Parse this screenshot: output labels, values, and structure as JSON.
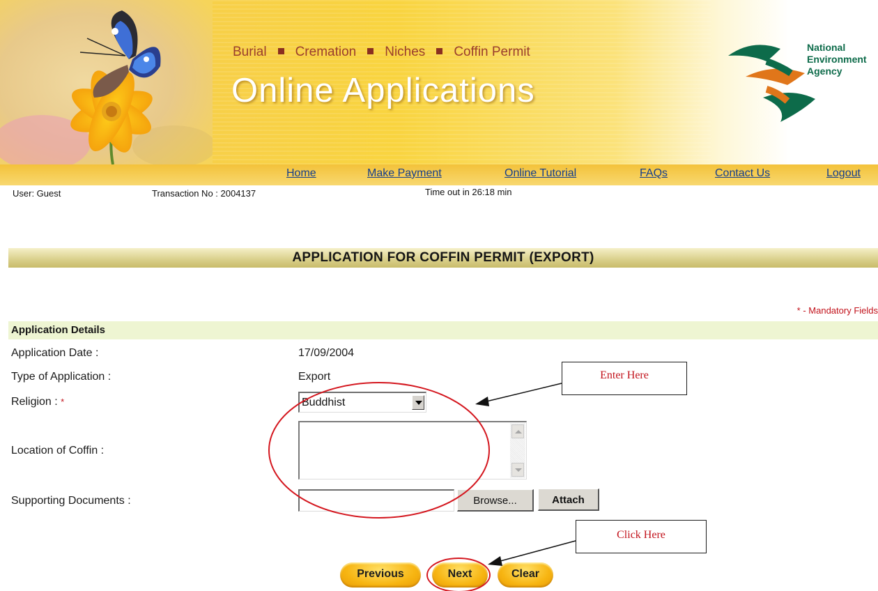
{
  "banner": {
    "service_links": [
      "Burial",
      "Cremation",
      "Niches",
      "Coffin Permit"
    ],
    "title": "Online Applications",
    "agency_name_lines": [
      "National",
      "Environment",
      "Agency"
    ]
  },
  "nav": {
    "items": [
      "Home",
      "Make Payment",
      "Online Tutorial",
      "FAQs",
      "Contact Us",
      "Logout"
    ]
  },
  "status": {
    "user": "User: Guest",
    "transaction": "Transaction No : 2004137",
    "timeout": "Time out in 26:18 min"
  },
  "page_title": "APPLICATION FOR COFFIN PERMIT (EXPORT)",
  "mandatory_note": "* - Mandatory Fields",
  "section_title": "Application Details",
  "form": {
    "application_date_label": "Application Date :",
    "application_date_value": "17/09/2004",
    "type_label": "Type of Application :",
    "type_value": "Export",
    "religion_label": "Religion :",
    "religion_required": "*",
    "religion_value": "Buddhist",
    "location_label": "Location of Coffin :",
    "location_value": "",
    "documents_label": "Supporting Documents :",
    "documents_value": "",
    "browse_label": "Browse...",
    "attach_label": "Attach"
  },
  "buttons": {
    "previous": "Previous",
    "next": "Next",
    "clear": "Clear"
  },
  "annotations": {
    "enter_here": "Enter Here",
    "click_here": "Click Here"
  },
  "colors": {
    "banner_yellow": "#f9d43f",
    "nav_link": "#153e8b",
    "required_red": "#c2121b",
    "annotation_red": "#d4161e",
    "section_bg": "#eef5d2"
  }
}
